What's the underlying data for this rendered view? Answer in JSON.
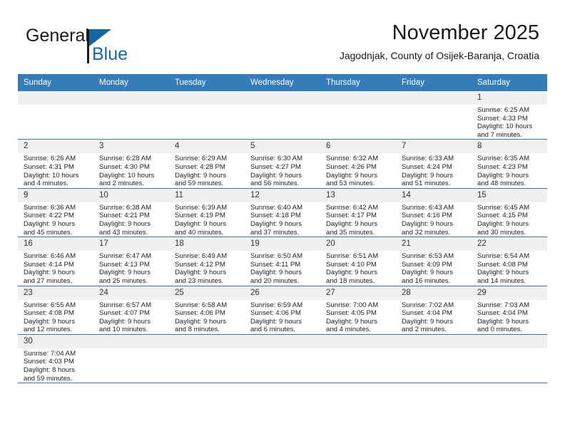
{
  "brand": {
    "name_top": "General",
    "name_bottom": "Blue",
    "logo_icon": "triangle-flag-icon",
    "accent_color": "#1565a8"
  },
  "header": {
    "title": "November 2025",
    "subtitle": "Jagodnjak, County of Osijek-Baranja, Croatia"
  },
  "theme": {
    "header_bar_color": "#357cba",
    "daynum_bg": "#f0f0f0",
    "grid_line_color": "#357cba"
  },
  "calendar": {
    "weekday_headers": [
      "Sunday",
      "Monday",
      "Tuesday",
      "Wednesday",
      "Thursday",
      "Friday",
      "Saturday"
    ],
    "weeks": [
      [
        {
          "day": "",
          "lines": []
        },
        {
          "day": "",
          "lines": []
        },
        {
          "day": "",
          "lines": []
        },
        {
          "day": "",
          "lines": []
        },
        {
          "day": "",
          "lines": []
        },
        {
          "day": "",
          "lines": []
        },
        {
          "day": "1",
          "lines": [
            "Sunrise: 6:25 AM",
            "Sunset: 4:33 PM",
            "Daylight: 10 hours",
            "and 7 minutes."
          ]
        }
      ],
      [
        {
          "day": "2",
          "lines": [
            "Sunrise: 6:26 AM",
            "Sunset: 4:31 PM",
            "Daylight: 10 hours",
            "and 4 minutes."
          ]
        },
        {
          "day": "3",
          "lines": [
            "Sunrise: 6:28 AM",
            "Sunset: 4:30 PM",
            "Daylight: 10 hours",
            "and 2 minutes."
          ]
        },
        {
          "day": "4",
          "lines": [
            "Sunrise: 6:29 AM",
            "Sunset: 4:28 PM",
            "Daylight: 9 hours",
            "and 59 minutes."
          ]
        },
        {
          "day": "5",
          "lines": [
            "Sunrise: 6:30 AM",
            "Sunset: 4:27 PM",
            "Daylight: 9 hours",
            "and 56 minutes."
          ]
        },
        {
          "day": "6",
          "lines": [
            "Sunrise: 6:32 AM",
            "Sunset: 4:26 PM",
            "Daylight: 9 hours",
            "and 53 minutes."
          ]
        },
        {
          "day": "7",
          "lines": [
            "Sunrise: 6:33 AM",
            "Sunset: 4:24 PM",
            "Daylight: 9 hours",
            "and 51 minutes."
          ]
        },
        {
          "day": "8",
          "lines": [
            "Sunrise: 6:35 AM",
            "Sunset: 4:23 PM",
            "Daylight: 9 hours",
            "and 48 minutes."
          ]
        }
      ],
      [
        {
          "day": "9",
          "lines": [
            "Sunrise: 6:36 AM",
            "Sunset: 4:22 PM",
            "Daylight: 9 hours",
            "and 45 minutes."
          ]
        },
        {
          "day": "10",
          "lines": [
            "Sunrise: 6:38 AM",
            "Sunset: 4:21 PM",
            "Daylight: 9 hours",
            "and 43 minutes."
          ]
        },
        {
          "day": "11",
          "lines": [
            "Sunrise: 6:39 AM",
            "Sunset: 4:19 PM",
            "Daylight: 9 hours",
            "and 40 minutes."
          ]
        },
        {
          "day": "12",
          "lines": [
            "Sunrise: 6:40 AM",
            "Sunset: 4:18 PM",
            "Daylight: 9 hours",
            "and 37 minutes."
          ]
        },
        {
          "day": "13",
          "lines": [
            "Sunrise: 6:42 AM",
            "Sunset: 4:17 PM",
            "Daylight: 9 hours",
            "and 35 minutes."
          ]
        },
        {
          "day": "14",
          "lines": [
            "Sunrise: 6:43 AM",
            "Sunset: 4:16 PM",
            "Daylight: 9 hours",
            "and 32 minutes."
          ]
        },
        {
          "day": "15",
          "lines": [
            "Sunrise: 6:45 AM",
            "Sunset: 4:15 PM",
            "Daylight: 9 hours",
            "and 30 minutes."
          ]
        }
      ],
      [
        {
          "day": "16",
          "lines": [
            "Sunrise: 6:46 AM",
            "Sunset: 4:14 PM",
            "Daylight: 9 hours",
            "and 27 minutes."
          ]
        },
        {
          "day": "17",
          "lines": [
            "Sunrise: 6:47 AM",
            "Sunset: 4:13 PM",
            "Daylight: 9 hours",
            "and 25 minutes."
          ]
        },
        {
          "day": "18",
          "lines": [
            "Sunrise: 6:49 AM",
            "Sunset: 4:12 PM",
            "Daylight: 9 hours",
            "and 23 minutes."
          ]
        },
        {
          "day": "19",
          "lines": [
            "Sunrise: 6:50 AM",
            "Sunset: 4:11 PM",
            "Daylight: 9 hours",
            "and 20 minutes."
          ]
        },
        {
          "day": "20",
          "lines": [
            "Sunrise: 6:51 AM",
            "Sunset: 4:10 PM",
            "Daylight: 9 hours",
            "and 18 minutes."
          ]
        },
        {
          "day": "21",
          "lines": [
            "Sunrise: 6:53 AM",
            "Sunset: 4:09 PM",
            "Daylight: 9 hours",
            "and 16 minutes."
          ]
        },
        {
          "day": "22",
          "lines": [
            "Sunrise: 6:54 AM",
            "Sunset: 4:08 PM",
            "Daylight: 9 hours",
            "and 14 minutes."
          ]
        }
      ],
      [
        {
          "day": "23",
          "lines": [
            "Sunrise: 6:55 AM",
            "Sunset: 4:08 PM",
            "Daylight: 9 hours",
            "and 12 minutes."
          ]
        },
        {
          "day": "24",
          "lines": [
            "Sunrise: 6:57 AM",
            "Sunset: 4:07 PM",
            "Daylight: 9 hours",
            "and 10 minutes."
          ]
        },
        {
          "day": "25",
          "lines": [
            "Sunrise: 6:58 AM",
            "Sunset: 4:06 PM",
            "Daylight: 9 hours",
            "and 8 minutes."
          ]
        },
        {
          "day": "26",
          "lines": [
            "Sunrise: 6:59 AM",
            "Sunset: 4:06 PM",
            "Daylight: 9 hours",
            "and 6 minutes."
          ]
        },
        {
          "day": "27",
          "lines": [
            "Sunrise: 7:00 AM",
            "Sunset: 4:05 PM",
            "Daylight: 9 hours",
            "and 4 minutes."
          ]
        },
        {
          "day": "28",
          "lines": [
            "Sunrise: 7:02 AM",
            "Sunset: 4:04 PM",
            "Daylight: 9 hours",
            "and 2 minutes."
          ]
        },
        {
          "day": "29",
          "lines": [
            "Sunrise: 7:03 AM",
            "Sunset: 4:04 PM",
            "Daylight: 9 hours",
            "and 0 minutes."
          ]
        }
      ],
      [
        {
          "day": "30",
          "lines": [
            "Sunrise: 7:04 AM",
            "Sunset: 4:03 PM",
            "Daylight: 8 hours",
            "and 59 minutes."
          ]
        },
        {
          "day": "",
          "lines": []
        },
        {
          "day": "",
          "lines": []
        },
        {
          "day": "",
          "lines": []
        },
        {
          "day": "",
          "lines": []
        },
        {
          "day": "",
          "lines": []
        },
        {
          "day": "",
          "lines": []
        }
      ]
    ]
  }
}
